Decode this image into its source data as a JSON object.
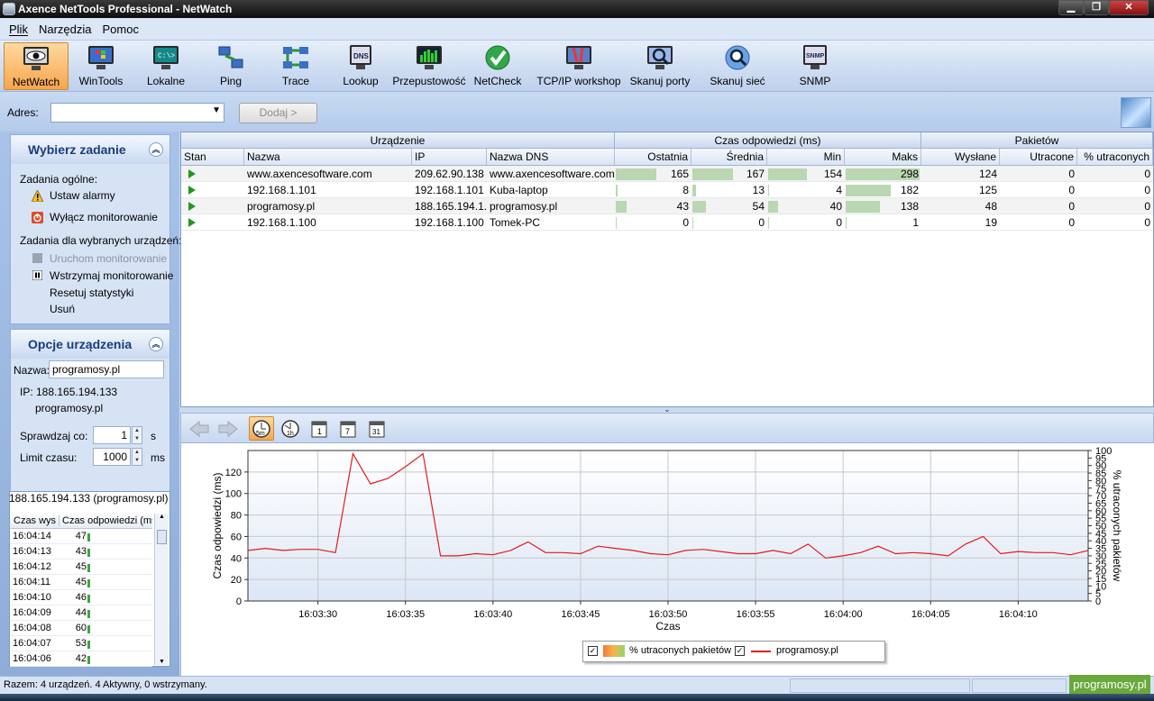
{
  "window": {
    "title": "Axence NetTools Professional - NetWatch"
  },
  "menu": [
    "Plik",
    "Narzędzia",
    "Pomoc"
  ],
  "toolbar": [
    {
      "label": "NetWatch",
      "icon": "monitor-eye-icon",
      "active": true
    },
    {
      "label": "WinTools",
      "icon": "windows-monitor-icon"
    },
    {
      "label": "Lokalne",
      "icon": "console-monitor-icon"
    },
    {
      "label": "Ping",
      "icon": "ping-icon"
    },
    {
      "label": "Trace",
      "icon": "trace-icon"
    },
    {
      "label": "Lookup",
      "icon": "dns-icon"
    },
    {
      "label": "Przepustowość",
      "icon": "bandwidth-icon"
    },
    {
      "label": "NetCheck",
      "icon": "check-icon"
    },
    {
      "label": "TCP/IP workshop",
      "icon": "workshop-icon"
    },
    {
      "label": "Skanuj porty",
      "icon": "scan-ports-icon"
    },
    {
      "label": "Skanuj sieć",
      "icon": "scan-network-icon"
    },
    {
      "label": "SNMP",
      "icon": "snmp-icon"
    }
  ],
  "address": {
    "label": "Adres:",
    "value": "",
    "add_button": "Dodaj >"
  },
  "tasks": {
    "title": "Wybierz zadanie",
    "general_label": "Zadania ogólne:",
    "set_alarms": "Ustaw alarmy",
    "disable_monitoring": "Wyłącz monitorowanie",
    "selected_label": "Zadania dla wybranych urządzeń:",
    "start_monitoring": "Uruchom monitorowanie",
    "pause_monitoring": "Wstrzymaj monitorowanie",
    "reset_stats": "Resetuj statystyki",
    "remove": "Usuń"
  },
  "options": {
    "title": "Opcje urządzenia",
    "name_label": "Nazwa:",
    "name_value": "programosy.pl",
    "ip_label": "IP: 188.165.194.133",
    "dns_value": "programosy.pl",
    "check_label": "Sprawdzaj co:",
    "check_value": "1",
    "check_unit": "s",
    "timeout_label": "Limit czasu:",
    "timeout_value": "1000",
    "timeout_unit": "ms"
  },
  "log": {
    "title": "188.165.194.133 (programosy.pl)",
    "col_time": "Czas wys",
    "col_resp": "Czas odpowiedzi (ms)",
    "rows": [
      {
        "time": "16:04:14",
        "value": "47"
      },
      {
        "time": "16:04:13",
        "value": "43"
      },
      {
        "time": "16:04:12",
        "value": "45"
      },
      {
        "time": "16:04:11",
        "value": "45"
      },
      {
        "time": "16:04:10",
        "value": "46"
      },
      {
        "time": "16:04:09",
        "value": "44"
      },
      {
        "time": "16:04:08",
        "value": "60"
      },
      {
        "time": "16:04:07",
        "value": "53"
      },
      {
        "time": "16:04:06",
        "value": "42"
      }
    ]
  },
  "grid": {
    "group_device": "Urządzenie",
    "group_response": "Czas odpowiedzi (ms)",
    "group_packets": "Pakietów",
    "cols": [
      "Stan",
      "Nazwa",
      "IP",
      "Nazwa DNS",
      "Ostatnia",
      "Średnia",
      "Min",
      "Maks",
      "Wysłane",
      "Utracone",
      "% utraconych"
    ],
    "bar_max": 298,
    "rows": [
      {
        "name": "www.axencesoftware.com",
        "ip": "209.62.90.138",
        "dns": "www.axencesoftware.com",
        "last": 165,
        "avg": 167,
        "min": 154,
        "max": 298,
        "sent": 124,
        "lost": 0,
        "pct": 0
      },
      {
        "name": "192.168.1.101",
        "ip": "192.168.1.101",
        "dns": "Kuba-laptop",
        "last": 8,
        "avg": 13,
        "min": 4,
        "max": 182,
        "sent": 125,
        "lost": 0,
        "pct": 0
      },
      {
        "name": "programosy.pl",
        "ip": "188.165.194.1...",
        "dns": "programosy.pl",
        "last": 43,
        "avg": 54,
        "min": 40,
        "max": 138,
        "sent": 48,
        "lost": 0,
        "pct": 0
      },
      {
        "name": "192.168.1.100",
        "ip": "192.168.1.100",
        "dns": "Tomek-PC",
        "last": 0,
        "avg": 0,
        "min": 0,
        "max": 1,
        "sent": 19,
        "lost": 0,
        "pct": 0
      }
    ]
  },
  "chart_toolbar": [
    {
      "icon": "back-arrow-icon"
    },
    {
      "icon": "forward-arrow-icon"
    },
    {
      "icon": "clock-5m-icon",
      "label": "5m",
      "active": true
    },
    {
      "icon": "clock-1h-icon",
      "label": "1h"
    },
    {
      "icon": "calendar-1-icon",
      "label": "1"
    },
    {
      "icon": "calendar-7-icon",
      "label": "7"
    },
    {
      "icon": "calendar-31-icon",
      "label": "31"
    }
  ],
  "chart_data": {
    "type": "line",
    "xlabel": "Czas",
    "ylabel": "Czas odpowiedzi (ms)",
    "y2label": "% utraconych pakietów",
    "ylim": [
      0,
      140
    ],
    "y2lim": [
      0,
      100
    ],
    "yticks": [
      0,
      20,
      40,
      60,
      80,
      100,
      120
    ],
    "y2ticks": [
      0,
      5,
      10,
      15,
      20,
      25,
      30,
      35,
      40,
      45,
      50,
      55,
      60,
      65,
      70,
      75,
      80,
      85,
      90,
      95,
      100
    ],
    "xlim": [
      "16:03:26",
      "16:04:14"
    ],
    "xticks": [
      "16:03:30",
      "16:03:35",
      "16:03:40",
      "16:03:45",
      "16:03:50",
      "16:03:55",
      "16:04:00",
      "16:04:05",
      "16:04:10"
    ],
    "grid": true,
    "series": [
      {
        "name": "programosy.pl",
        "color": "#e41a1c",
        "x": [
          "16:03:26",
          "16:03:27",
          "16:03:28",
          "16:03:29",
          "16:03:30",
          "16:03:31",
          "16:03:32",
          "16:03:33",
          "16:03:34",
          "16:03:35",
          "16:03:36",
          "16:03:37",
          "16:03:38",
          "16:03:39",
          "16:03:40",
          "16:03:41",
          "16:03:42",
          "16:03:43",
          "16:03:44",
          "16:03:45",
          "16:03:46",
          "16:03:47",
          "16:03:48",
          "16:03:49",
          "16:03:50",
          "16:03:51",
          "16:03:52",
          "16:03:53",
          "16:03:54",
          "16:03:55",
          "16:03:56",
          "16:03:57",
          "16:03:58",
          "16:03:59",
          "16:04:00",
          "16:04:01",
          "16:04:02",
          "16:04:03",
          "16:04:04",
          "16:04:05",
          "16:04:06",
          "16:04:07",
          "16:04:08",
          "16:04:09",
          "16:04:10",
          "16:04:11",
          "16:04:12",
          "16:04:13",
          "16:04:14"
        ],
        "values": [
          47,
          49,
          47,
          48,
          48,
          45,
          137,
          109,
          114,
          125,
          137,
          42,
          42,
          44,
          43,
          47,
          55,
          45,
          45,
          44,
          51,
          49,
          47,
          44,
          43,
          47,
          48,
          46,
          44,
          44,
          47,
          44,
          53,
          40,
          42,
          45,
          51,
          44,
          45,
          44,
          42,
          53,
          60,
          44,
          46,
          45,
          45,
          43,
          47
        ]
      }
    ],
    "legend": [
      "% utraconych pakietów",
      "programosy.pl"
    ],
    "legend_position": "bottom"
  },
  "status": {
    "text": "Razem: 4 urządzeń. 4 Aktywny, 0 wstrzymany.",
    "brand": "programosy.pl"
  }
}
